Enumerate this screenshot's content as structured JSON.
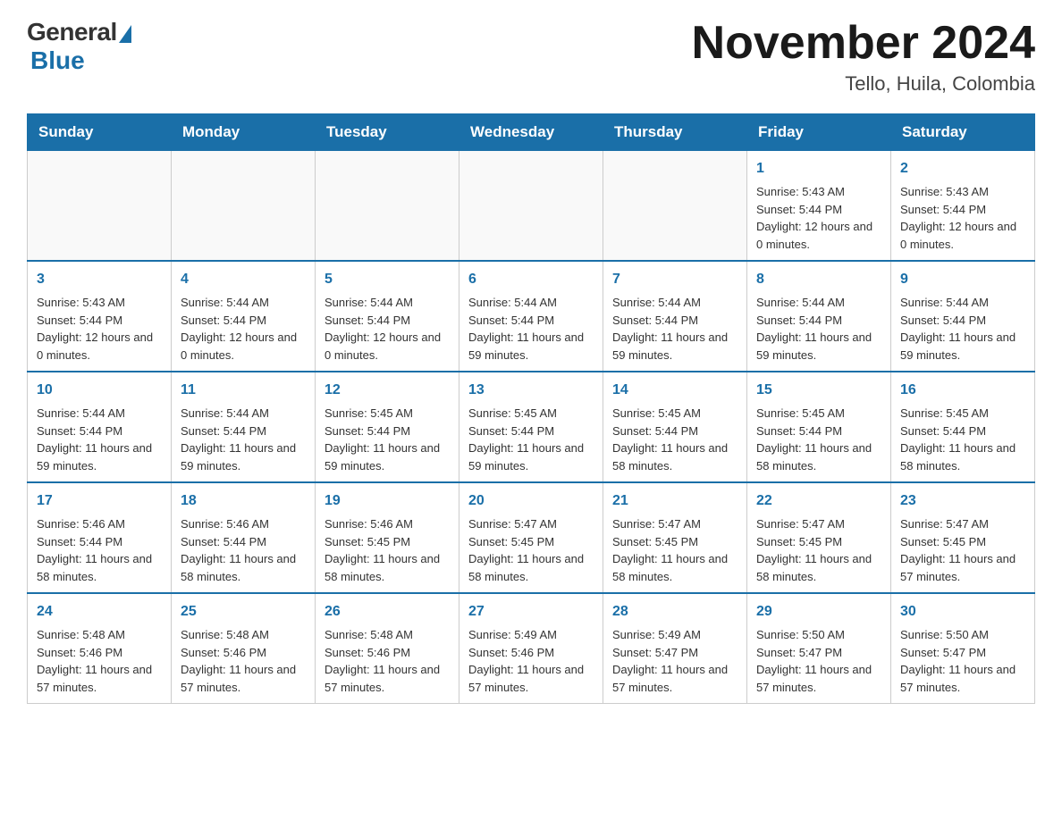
{
  "header": {
    "logo": {
      "general": "General",
      "blue": "Blue"
    },
    "title": "November 2024",
    "location": "Tello, Huila, Colombia"
  },
  "days_of_week": [
    "Sunday",
    "Monday",
    "Tuesday",
    "Wednesday",
    "Thursday",
    "Friday",
    "Saturday"
  ],
  "weeks": [
    {
      "days": [
        {
          "number": "",
          "empty": true
        },
        {
          "number": "",
          "empty": true
        },
        {
          "number": "",
          "empty": true
        },
        {
          "number": "",
          "empty": true
        },
        {
          "number": "",
          "empty": true
        },
        {
          "number": "1",
          "sunrise": "Sunrise: 5:43 AM",
          "sunset": "Sunset: 5:44 PM",
          "daylight": "Daylight: 12 hours and 0 minutes."
        },
        {
          "number": "2",
          "sunrise": "Sunrise: 5:43 AM",
          "sunset": "Sunset: 5:44 PM",
          "daylight": "Daylight: 12 hours and 0 minutes."
        }
      ]
    },
    {
      "days": [
        {
          "number": "3",
          "sunrise": "Sunrise: 5:43 AM",
          "sunset": "Sunset: 5:44 PM",
          "daylight": "Daylight: 12 hours and 0 minutes."
        },
        {
          "number": "4",
          "sunrise": "Sunrise: 5:44 AM",
          "sunset": "Sunset: 5:44 PM",
          "daylight": "Daylight: 12 hours and 0 minutes."
        },
        {
          "number": "5",
          "sunrise": "Sunrise: 5:44 AM",
          "sunset": "Sunset: 5:44 PM",
          "daylight": "Daylight: 12 hours and 0 minutes."
        },
        {
          "number": "6",
          "sunrise": "Sunrise: 5:44 AM",
          "sunset": "Sunset: 5:44 PM",
          "daylight": "Daylight: 11 hours and 59 minutes."
        },
        {
          "number": "7",
          "sunrise": "Sunrise: 5:44 AM",
          "sunset": "Sunset: 5:44 PM",
          "daylight": "Daylight: 11 hours and 59 minutes."
        },
        {
          "number": "8",
          "sunrise": "Sunrise: 5:44 AM",
          "sunset": "Sunset: 5:44 PM",
          "daylight": "Daylight: 11 hours and 59 minutes."
        },
        {
          "number": "9",
          "sunrise": "Sunrise: 5:44 AM",
          "sunset": "Sunset: 5:44 PM",
          "daylight": "Daylight: 11 hours and 59 minutes."
        }
      ]
    },
    {
      "days": [
        {
          "number": "10",
          "sunrise": "Sunrise: 5:44 AM",
          "sunset": "Sunset: 5:44 PM",
          "daylight": "Daylight: 11 hours and 59 minutes."
        },
        {
          "number": "11",
          "sunrise": "Sunrise: 5:44 AM",
          "sunset": "Sunset: 5:44 PM",
          "daylight": "Daylight: 11 hours and 59 minutes."
        },
        {
          "number": "12",
          "sunrise": "Sunrise: 5:45 AM",
          "sunset": "Sunset: 5:44 PM",
          "daylight": "Daylight: 11 hours and 59 minutes."
        },
        {
          "number": "13",
          "sunrise": "Sunrise: 5:45 AM",
          "sunset": "Sunset: 5:44 PM",
          "daylight": "Daylight: 11 hours and 59 minutes."
        },
        {
          "number": "14",
          "sunrise": "Sunrise: 5:45 AM",
          "sunset": "Sunset: 5:44 PM",
          "daylight": "Daylight: 11 hours and 58 minutes."
        },
        {
          "number": "15",
          "sunrise": "Sunrise: 5:45 AM",
          "sunset": "Sunset: 5:44 PM",
          "daylight": "Daylight: 11 hours and 58 minutes."
        },
        {
          "number": "16",
          "sunrise": "Sunrise: 5:45 AM",
          "sunset": "Sunset: 5:44 PM",
          "daylight": "Daylight: 11 hours and 58 minutes."
        }
      ]
    },
    {
      "days": [
        {
          "number": "17",
          "sunrise": "Sunrise: 5:46 AM",
          "sunset": "Sunset: 5:44 PM",
          "daylight": "Daylight: 11 hours and 58 minutes."
        },
        {
          "number": "18",
          "sunrise": "Sunrise: 5:46 AM",
          "sunset": "Sunset: 5:44 PM",
          "daylight": "Daylight: 11 hours and 58 minutes."
        },
        {
          "number": "19",
          "sunrise": "Sunrise: 5:46 AM",
          "sunset": "Sunset: 5:45 PM",
          "daylight": "Daylight: 11 hours and 58 minutes."
        },
        {
          "number": "20",
          "sunrise": "Sunrise: 5:47 AM",
          "sunset": "Sunset: 5:45 PM",
          "daylight": "Daylight: 11 hours and 58 minutes."
        },
        {
          "number": "21",
          "sunrise": "Sunrise: 5:47 AM",
          "sunset": "Sunset: 5:45 PM",
          "daylight": "Daylight: 11 hours and 58 minutes."
        },
        {
          "number": "22",
          "sunrise": "Sunrise: 5:47 AM",
          "sunset": "Sunset: 5:45 PM",
          "daylight": "Daylight: 11 hours and 58 minutes."
        },
        {
          "number": "23",
          "sunrise": "Sunrise: 5:47 AM",
          "sunset": "Sunset: 5:45 PM",
          "daylight": "Daylight: 11 hours and 57 minutes."
        }
      ]
    },
    {
      "days": [
        {
          "number": "24",
          "sunrise": "Sunrise: 5:48 AM",
          "sunset": "Sunset: 5:46 PM",
          "daylight": "Daylight: 11 hours and 57 minutes."
        },
        {
          "number": "25",
          "sunrise": "Sunrise: 5:48 AM",
          "sunset": "Sunset: 5:46 PM",
          "daylight": "Daylight: 11 hours and 57 minutes."
        },
        {
          "number": "26",
          "sunrise": "Sunrise: 5:48 AM",
          "sunset": "Sunset: 5:46 PM",
          "daylight": "Daylight: 11 hours and 57 minutes."
        },
        {
          "number": "27",
          "sunrise": "Sunrise: 5:49 AM",
          "sunset": "Sunset: 5:46 PM",
          "daylight": "Daylight: 11 hours and 57 minutes."
        },
        {
          "number": "28",
          "sunrise": "Sunrise: 5:49 AM",
          "sunset": "Sunset: 5:47 PM",
          "daylight": "Daylight: 11 hours and 57 minutes."
        },
        {
          "number": "29",
          "sunrise": "Sunrise: 5:50 AM",
          "sunset": "Sunset: 5:47 PM",
          "daylight": "Daylight: 11 hours and 57 minutes."
        },
        {
          "number": "30",
          "sunrise": "Sunrise: 5:50 AM",
          "sunset": "Sunset: 5:47 PM",
          "daylight": "Daylight: 11 hours and 57 minutes."
        }
      ]
    }
  ]
}
